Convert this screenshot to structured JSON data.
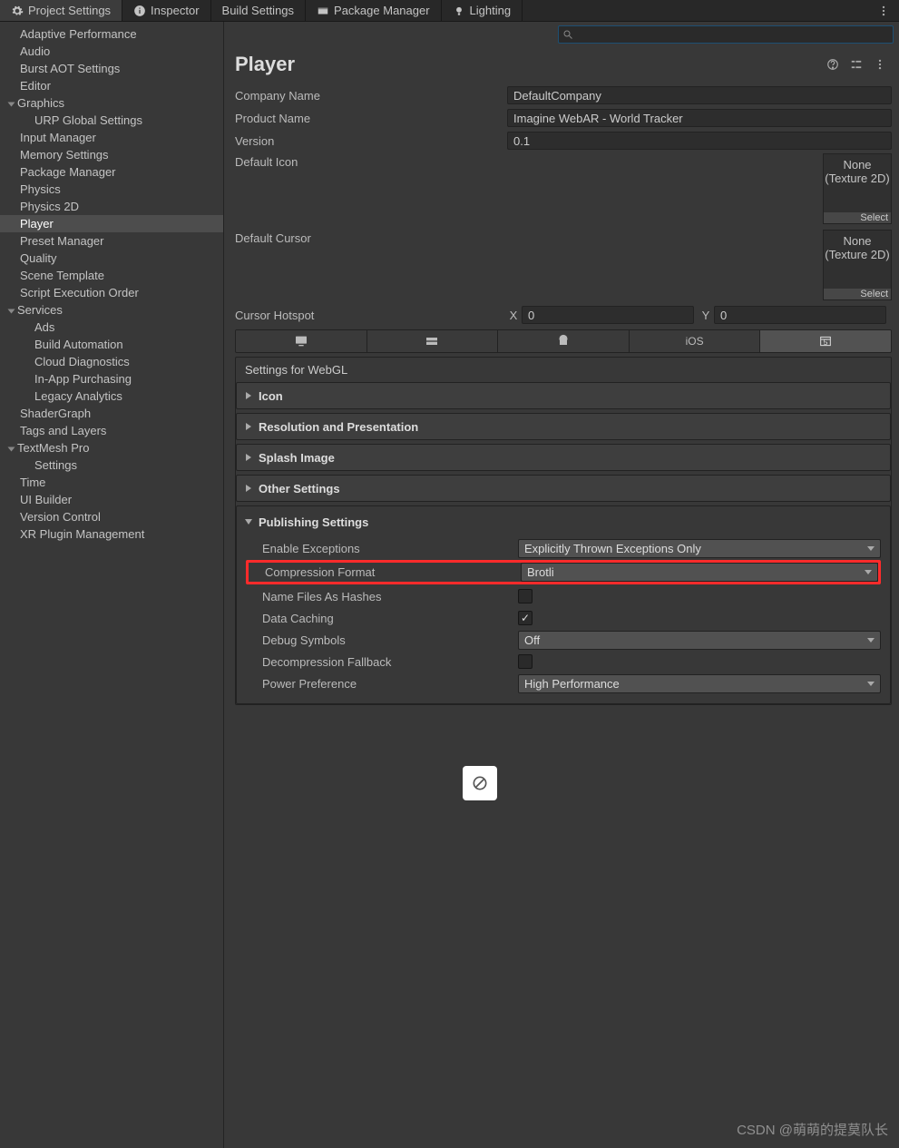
{
  "tabs": [
    {
      "label": "Project Settings",
      "active": true,
      "icon": "gear"
    },
    {
      "label": "Inspector",
      "icon": "info"
    },
    {
      "label": "Build Settings"
    },
    {
      "label": "Package Manager",
      "icon": "package"
    },
    {
      "label": "Lighting",
      "icon": "light"
    }
  ],
  "sidebar": [
    {
      "label": "Adaptive Performance"
    },
    {
      "label": "Audio"
    },
    {
      "label": "Burst AOT Settings"
    },
    {
      "label": "Editor"
    },
    {
      "label": "Graphics",
      "fold": true
    },
    {
      "label": "URP Global Settings",
      "child": true
    },
    {
      "label": "Input Manager"
    },
    {
      "label": "Memory Settings"
    },
    {
      "label": "Package Manager"
    },
    {
      "label": "Physics"
    },
    {
      "label": "Physics 2D"
    },
    {
      "label": "Player",
      "sel": true
    },
    {
      "label": "Preset Manager"
    },
    {
      "label": "Quality"
    },
    {
      "label": "Scene Template"
    },
    {
      "label": "Script Execution Order"
    },
    {
      "label": "Services",
      "fold": true
    },
    {
      "label": "Ads",
      "child": true
    },
    {
      "label": "Build Automation",
      "child": true
    },
    {
      "label": "Cloud Diagnostics",
      "child": true
    },
    {
      "label": "In-App Purchasing",
      "child": true
    },
    {
      "label": "Legacy Analytics",
      "child": true
    },
    {
      "label": "ShaderGraph"
    },
    {
      "label": "Tags and Layers"
    },
    {
      "label": "TextMesh Pro",
      "fold": true
    },
    {
      "label": "Settings",
      "child": true
    },
    {
      "label": "Time"
    },
    {
      "label": "UI Builder"
    },
    {
      "label": "Version Control"
    },
    {
      "label": "XR Plugin Management"
    }
  ],
  "header": {
    "title": "Player"
  },
  "fields": {
    "companyName": {
      "label": "Company Name",
      "value": "DefaultCompany"
    },
    "productName": {
      "label": "Product Name",
      "value": "Imagine WebAR - World Tracker"
    },
    "version": {
      "label": "Version",
      "value": "0.1"
    },
    "defaultIcon": {
      "label": "Default Icon",
      "none": "None",
      "type": "(Texture 2D)",
      "select": "Select"
    },
    "defaultCursor": {
      "label": "Default Cursor",
      "none": "None",
      "type": "(Texture 2D)",
      "select": "Select"
    },
    "cursorHotspot": {
      "label": "Cursor Hotspot",
      "xLabel": "X",
      "x": "0",
      "yLabel": "Y",
      "y": "0"
    }
  },
  "platformTabs": [
    "standalone",
    "dedicated",
    "android",
    "ios",
    "webgl"
  ],
  "activePlatform": 4,
  "settingsFor": "Settings for WebGL",
  "sections": {
    "icon": "Icon",
    "resolution": "Resolution and Presentation",
    "splash": "Splash Image",
    "other": "Other Settings",
    "publishing": "Publishing Settings"
  },
  "publishing": {
    "enableExceptions": {
      "label": "Enable Exceptions",
      "value": "Explicitly Thrown Exceptions Only"
    },
    "compressionFormat": {
      "label": "Compression Format",
      "value": "Brotli"
    },
    "nameFilesAsHashes": {
      "label": "Name Files As Hashes",
      "checked": false
    },
    "dataCaching": {
      "label": "Data Caching",
      "checked": true
    },
    "debugSymbols": {
      "label": "Debug Symbols",
      "value": "Off"
    },
    "decompressionFallback": {
      "label": "Decompression Fallback",
      "checked": false
    },
    "powerPreference": {
      "label": "Power Preference",
      "value": "High Performance"
    }
  },
  "watermark": "CSDN @萌萌的提莫队长"
}
